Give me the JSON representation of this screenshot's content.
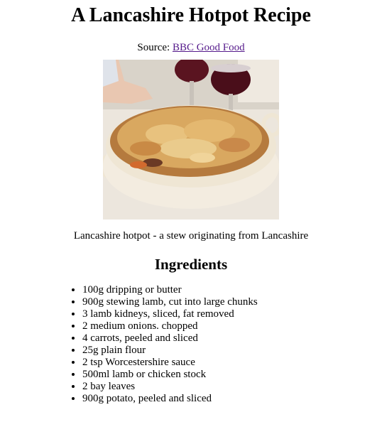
{
  "page": {
    "title": "A Lancashire Hotpot Recipe",
    "source_prefix": "Source: ",
    "source_link": "BBC Good Food",
    "image_caption": "Lancashire hotpot - a stew originating from Lancashire",
    "ingredients_heading": "Ingredients",
    "ingredients": [
      "100g dripping or butter",
      "900g stewing lamb, cut into large chunks",
      "3 lamb kidneys, sliced, fat removed",
      "2 medium onions. chopped",
      "4 carrots, peeled and sliced",
      "25g plain flour",
      "2 tsp Worcestershire sauce",
      "500ml lamb or chicken stock",
      "2 bay leaves",
      "900g potato, peeled and sliced"
    ]
  },
  "colors": {
    "link_visited": "#551a8b",
    "text": "#000000",
    "background": "#ffffff"
  }
}
